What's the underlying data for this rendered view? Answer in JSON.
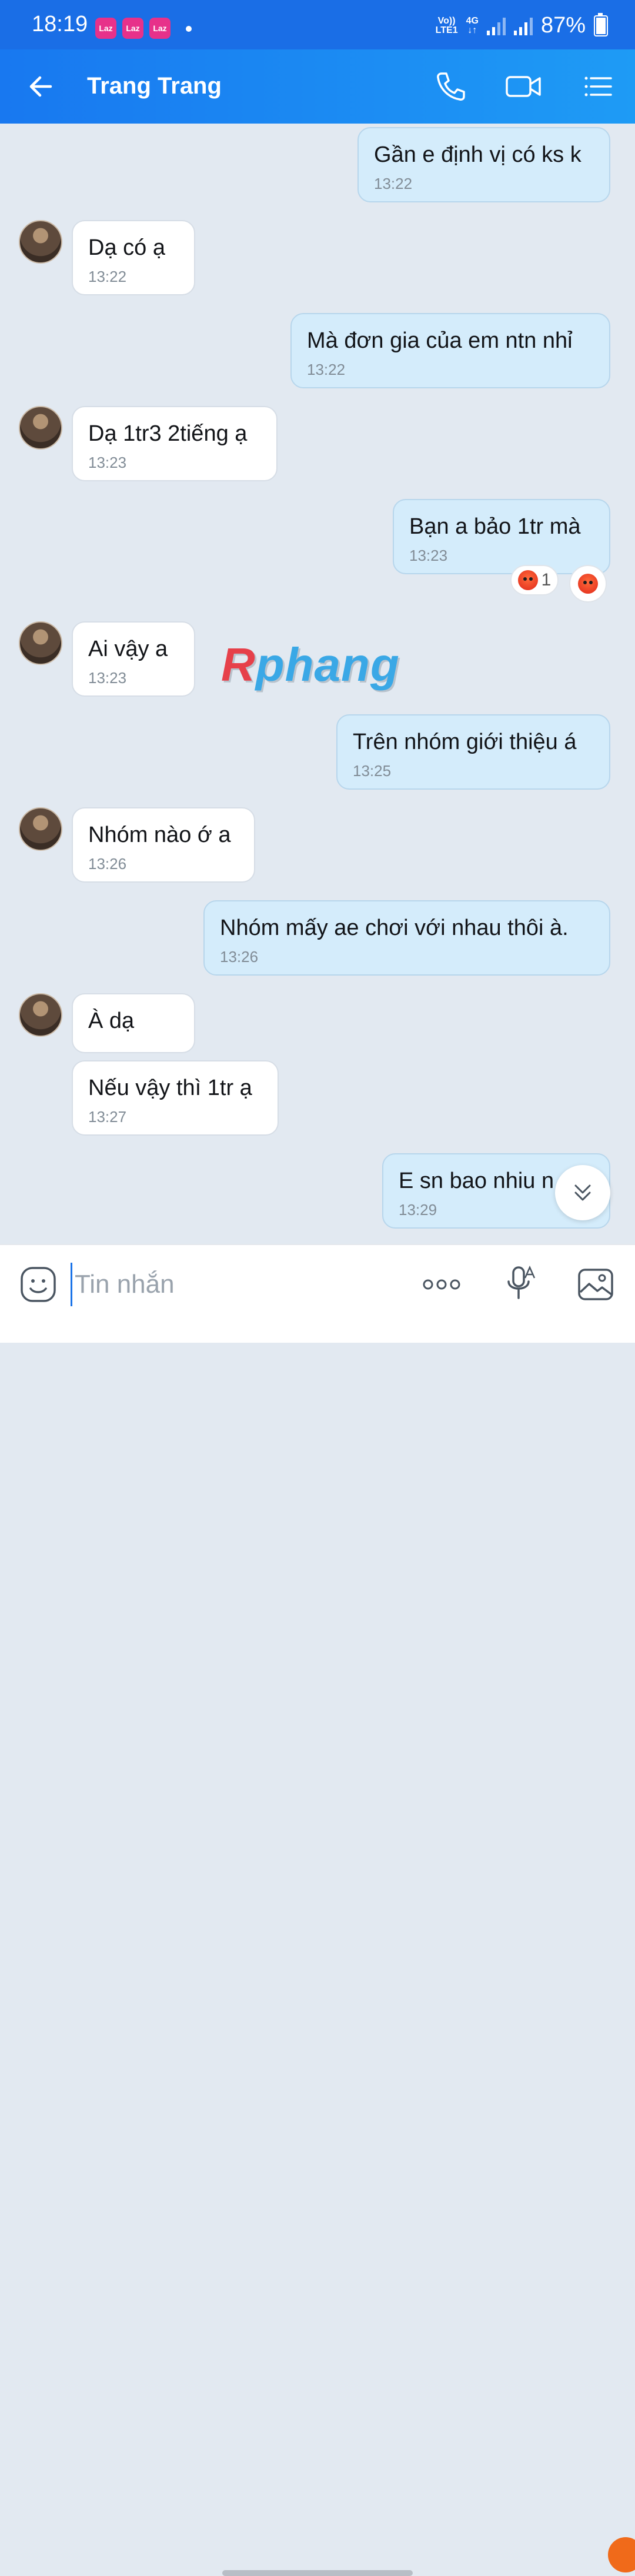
{
  "status_bar": {
    "time": "18:19",
    "notif_label": "Laz",
    "network_top": "Vo))",
    "network_bottom": "LTE1",
    "network_type": "4G",
    "battery": "87%",
    "battery_level": 0.87
  },
  "header": {
    "title": "Trang Trang",
    "back_icon": "arrow-left-icon",
    "call_icon": "phone-icon",
    "video_icon": "video-icon",
    "menu_icon": "list-menu-icon"
  },
  "messages": [
    {
      "side": "out",
      "text": "Gần e định vị có ks k",
      "time": "13:22"
    },
    {
      "side": "in",
      "text": "Dạ có ạ",
      "time": "13:22"
    },
    {
      "side": "out",
      "text": "Mà đơn gia của em ntn nhỉ",
      "time": "13:22"
    },
    {
      "side": "in",
      "text": "Dạ 1tr3 2tiếng ạ",
      "time": "13:23"
    },
    {
      "side": "out",
      "text": "Bạn a bảo 1tr mà",
      "time": "13:23",
      "reaction_count": "1"
    },
    {
      "side": "in",
      "text": "Ai vậy a",
      "time": "13:23"
    },
    {
      "side": "out",
      "text": "Trên nhóm giới thiệu á",
      "time": "13:25"
    },
    {
      "side": "in",
      "text": "Nhóm nào ớ a",
      "time": "13:26"
    },
    {
      "side": "out",
      "text": "Nhóm mấy ae chơi với nhau thôi à.",
      "time": "13:26"
    },
    {
      "side": "in",
      "text": "À dạ",
      "time": ""
    },
    {
      "side": "in",
      "text": "Nếu vậy thì 1tr ạ",
      "time": "13:27"
    },
    {
      "side": "out",
      "text": "E sn bao nhiu n",
      "time": "13:29"
    }
  ],
  "watermark": {
    "first": "R",
    "rest": "phang"
  },
  "input": {
    "placeholder": "Tin nhắn",
    "value": "",
    "emoji_icon": "sticker-smile-icon",
    "more_icon": "more-dots-icon",
    "voice_icon": "voice-text-mic-icon",
    "image_icon": "image-gallery-icon"
  },
  "colors": {
    "header": "#1878f0",
    "bubble_out": "#d4ecfb",
    "bubble_in": "#ffffff",
    "background": "#e2e9f1"
  }
}
